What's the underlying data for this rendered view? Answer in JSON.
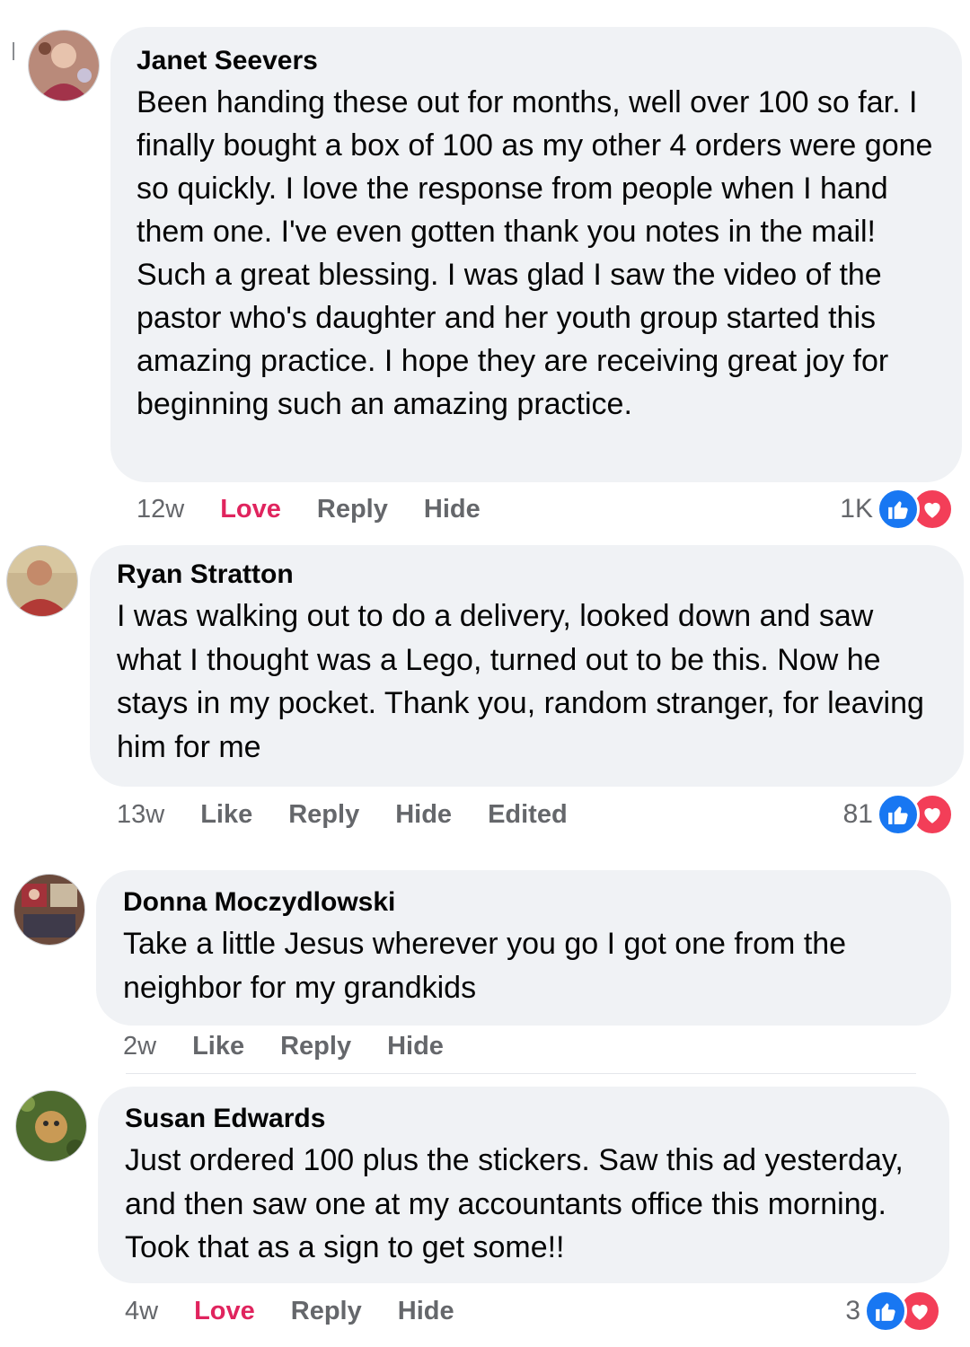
{
  "comments": [
    {
      "author": "Janet Seevers",
      "text": "Been handing these out for months, well over 100 so far. I finally bought a box of 100 as my other 4 orders were gone so quickly. I love the response from people when I hand them one. I've even gotten thank you notes in the mail! Such a great blessing. I was glad I saw the video of the pastor who's daughter and her youth group started this amazing practice. I hope they are receiving great joy for beginning such an amazing practice.",
      "time": "12w",
      "like_label": "Love",
      "reply_label": "Reply",
      "hide_label": "Hide",
      "reaction_count": "1K"
    },
    {
      "author": "Ryan Stratton",
      "text": "I was walking out to do a delivery, looked down and saw what I thought was a Lego, turned out to be this. Now he stays in my pocket. Thank you, random stranger, for leaving him for me",
      "time": "13w",
      "like_label": "Like",
      "reply_label": "Reply",
      "hide_label": "Hide",
      "edited_label": "Edited",
      "reaction_count": "81"
    },
    {
      "author": "Donna Moczydlowski",
      "text": "Take a little Jesus wherever you go I got one from the neighbor for my grandkids",
      "time": "2w",
      "like_label": "Like",
      "reply_label": "Reply",
      "hide_label": "Hide"
    },
    {
      "author": "Susan Edwards",
      "text": "Just ordered 100 plus the stickers. Saw this ad yesterday, and then saw one at my accountants office this morning. Took that as a sign to get some!!",
      "time": "4w",
      "like_label": "Love",
      "reply_label": "Reply",
      "hide_label": "Hide",
      "reaction_count": "3"
    }
  ],
  "colors": {
    "bubble": "#f0f2f5",
    "meta": "#65676b",
    "love": "#e0245e",
    "like_icon": "#1877f2",
    "love_icon": "#f33e58"
  },
  "icons": {
    "like": "thumbs-up-icon",
    "love": "heart-icon"
  }
}
